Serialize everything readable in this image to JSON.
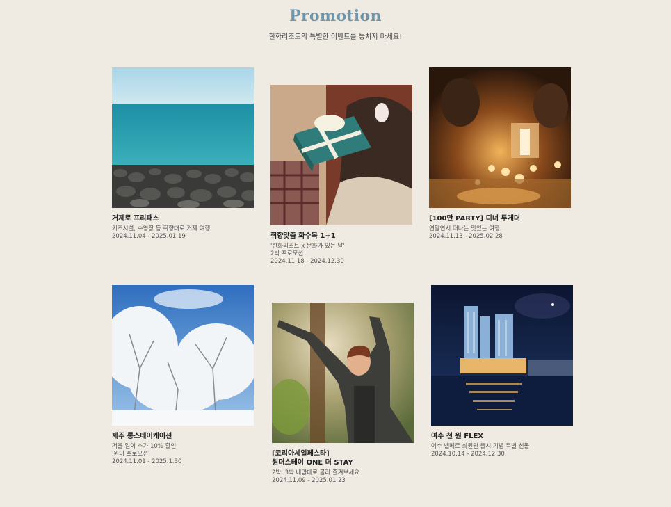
{
  "header": {
    "title": "Promotion",
    "subtitle": "한화리조트의 특별한 이벤트를 놓치지 마세요!"
  },
  "promotions": [
    {
      "name": "거제로 프리패스",
      "desc_lines": [
        "키즈시설, 수영장 등 취향대로 거제 여행"
      ],
      "date": "2024.11.04 - 2025.01.19",
      "image": "sea-rocks-photo"
    },
    {
      "name": "취향맞춤 화수목 1+1",
      "desc_lines": [
        "'한화리조트 x 문화가 있는 날'",
        "2박 프로모션"
      ],
      "date": "2024.11.18 - 2024.12.30",
      "image": "gift-box-photo"
    },
    {
      "name": "[100만 PARTY] 디너 투게더",
      "desc_lines": [
        "연말연시 떠나는 맛있는 여행"
      ],
      "date": "2024.11.13 - 2025.02.28",
      "image": "dinner-party-photo"
    },
    {
      "name": "제주 롱스테이케이션",
      "desc_lines": [
        "겨울 일이 추가 10% 할인",
        "'윈터 프로모션'"
      ],
      "date": "2024.11.01 - 2025.1.30",
      "image": "snowy-trees-photo"
    },
    {
      "name_lines": [
        "[코리아세일페스타]",
        "원더스테이 ONE 더 STAY"
      ],
      "desc_lines": [
        "2박, 3박 내맘대로 골라 즐겨보세요"
      ],
      "date": "2024.11.09 - 2025.01.23",
      "image": "forest-woman-photo"
    },
    {
      "name": "여수 천 원 FLEX",
      "desc_lines": [
        "여수 벨메르 회원권 출시 기념 특별 선물"
      ],
      "date": "2024.10.14 - 2024.12.30",
      "image": "night-hotel-photo"
    }
  ]
}
